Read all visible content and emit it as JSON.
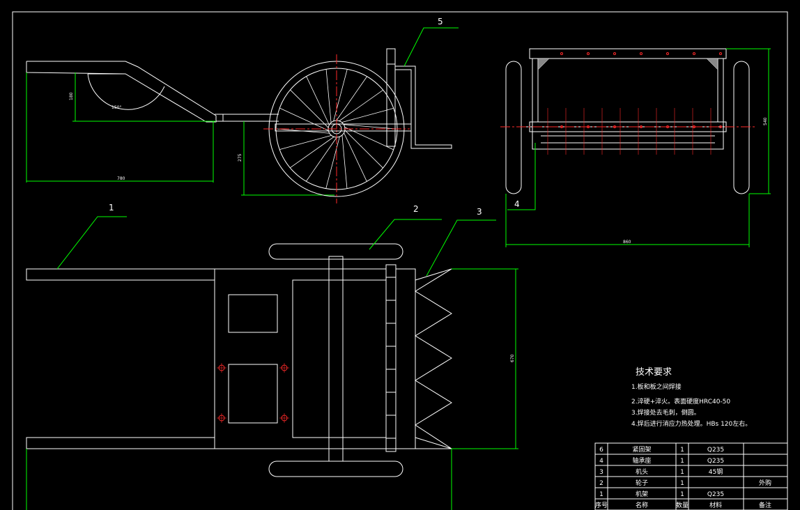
{
  "balloons": {
    "b1": "1",
    "b2": "2",
    "b3": "3",
    "b4": "4",
    "b5": "5"
  },
  "dimensions": {
    "d_handle_h": "180",
    "d_angle": "150°",
    "d_len_side": "780",
    "d_axle_h": "275",
    "d_front_h": "540",
    "d_front_w": "860",
    "d_plan_w": "670"
  },
  "tech": {
    "title": "技术要求",
    "r1": "1.板和板之间焊接",
    "r2": "2.淬硬+淬火。表面硬度HRC40-50",
    "r3": "3.焊接处去毛刺，倒圆。",
    "r4": "4.焊后进行消应力热处理。HBs  120左右。"
  },
  "table": {
    "rows": [
      {
        "no": "6",
        "name": "紧固架",
        "qty": "1",
        "mat": "Q235",
        "note": ""
      },
      {
        "no": "4",
        "name": "轴承座",
        "qty": "1",
        "mat": "Q235",
        "note": ""
      },
      {
        "no": "3",
        "name": "机头",
        "qty": "1",
        "mat": "45钢",
        "note": ""
      },
      {
        "no": "2",
        "name": "轮子",
        "qty": "1",
        "mat": "",
        "note": "外购"
      },
      {
        "no": "1",
        "name": "机架",
        "qty": "1",
        "mat": "Q235",
        "note": ""
      }
    ],
    "header": {
      "no": "序号",
      "name": "名称",
      "qty": "数量",
      "mat": "材料",
      "note": "备注"
    }
  },
  "colors": {
    "dim": "#00ff00",
    "line": "#ffffff",
    "center": "#ff2a2a",
    "bg": "#000000"
  }
}
